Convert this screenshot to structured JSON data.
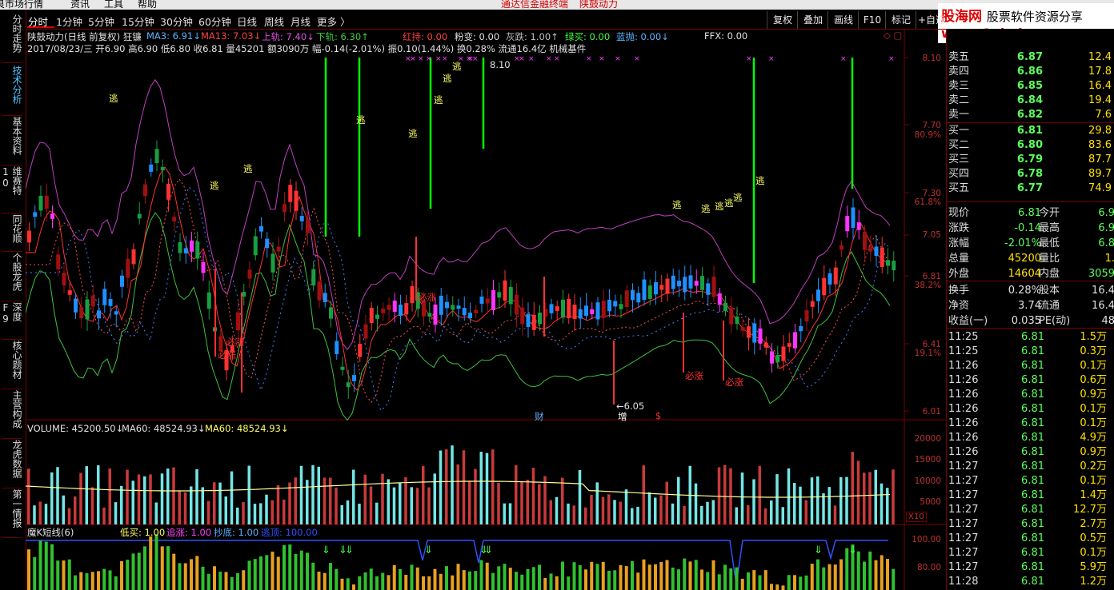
{
  "menu": {
    "items": [
      "良市场行情",
      "资讯",
      "工具",
      "帮助"
    ],
    "center": [
      "通达信金融终端",
      "陕鼓动力"
    ]
  },
  "left_tabs": [
    {
      "label": "分时走势",
      "active": false
    },
    {
      "label": "技术分析",
      "active": true
    },
    {
      "label": "基本资料",
      "active": false
    },
    {
      "label": "维赛特10",
      "active": false
    },
    {
      "label": "同花顺",
      "active": false
    },
    {
      "label": "个股龙虎",
      "active": false
    },
    {
      "label": "深度F9",
      "active": false
    },
    {
      "label": "核心题材",
      "active": false
    },
    {
      "label": "主营构成",
      "active": false
    },
    {
      "label": "龙虎数据",
      "active": false
    },
    {
      "label": "第一情报",
      "active": false
    }
  ],
  "period_tabs": [
    "分时",
    "1分钟",
    "5分钟",
    "15分钟",
    "30分钟",
    "60分钟",
    "日线",
    "周线",
    "月线",
    "更多 〉"
  ],
  "right_buttons": [
    "复权",
    "叠加",
    "画线",
    "F10",
    "标记",
    "+自选"
  ],
  "logo": {
    "line1_a": "股海网",
    "line1_b": "股票软件资源分享",
    "line2": "www.Guhai.com.cn"
  },
  "header": {
    "stock_title": "陕鼓动力(日线 前复权) 狂镰",
    "ma3": "MA3: 6.91↓",
    "ma13": "MA13: 7.03↓",
    "upper": "上轨: 7.40↓",
    "lower": "下轨: 6.30↑",
    "red_hold": "红持: 0.00",
    "pink": "粉变: 0.00",
    "gray": "灰跌: 1.00↑",
    "green_buy": "绿买: 0.00",
    "blue_throw": "蓝抛: 0.00↓",
    "ffx": "FFX: 0.00",
    "info_line": "2017/08/23/三 开6.90 高6.90 低6.80 收6.81 量45201 额3090万 幅-0.14(-2.01%) 振0.10(1.44%) 换0.28% 流通16.4亿 机械基件"
  },
  "price_axis": [
    "8.10",
    "7.70",
    "7.30",
    "7.05",
    "6.81",
    "6.41",
    "6.01"
  ],
  "pct_axis": [
    "80.9%",
    "61.8%",
    "38.2%",
    "19.1%"
  ],
  "annotations": {
    "escape": "逃",
    "must_rise": "必涨",
    "high_marker": "8.10",
    "low_marker": "←6.05",
    "cai": "财",
    "zeng": "增",
    "dollar": "$"
  },
  "volume_header": {
    "volume": "VOLUME: 45200.50↓",
    "ma60a": "MA60: 48524.93↓",
    "ma60b": "MA60: 48524.93↓"
  },
  "volume_axis": [
    "20000",
    "15000",
    "10000",
    "5000"
  ],
  "volume_unit": "X10",
  "indicator_header": {
    "name": "魔K短线(6)",
    "low_buy": "低买: 1.00",
    "chase": "追涨: 1.00",
    "bottom": "抄底: 1.00",
    "escape_top": "逃顶: 100.00"
  },
  "indicator_axis": [
    "100.00",
    "80.00"
  ],
  "order_book": [
    {
      "label": "卖五",
      "price": "6.87",
      "vol": "12.4"
    },
    {
      "label": "卖四",
      "price": "6.86",
      "vol": "17.8"
    },
    {
      "label": "卖三",
      "price": "6.85",
      "vol": "16.4"
    },
    {
      "label": "卖二",
      "price": "6.84",
      "vol": "19.4"
    },
    {
      "label": "卖一",
      "price": "6.82",
      "vol": "7.6"
    },
    {
      "label": "买一",
      "price": "6.81",
      "vol": "29.8"
    },
    {
      "label": "买二",
      "price": "6.80",
      "vol": "83.6"
    },
    {
      "label": "买三",
      "price": "6.79",
      "vol": "87.7"
    },
    {
      "label": "买四",
      "price": "6.78",
      "vol": "89.7"
    },
    {
      "label": "买五",
      "price": "6.77",
      "vol": "74.9"
    }
  ],
  "quote": [
    {
      "k1": "现价",
      "v1": "6.81",
      "k2": "今开",
      "v2": "6.9"
    },
    {
      "k1": "涨跌",
      "v1": "-0.14",
      "k2": "最高",
      "v2": "6.9"
    },
    {
      "k1": "涨幅",
      "v1": "-2.01%",
      "k2": "最低",
      "v2": "6.8"
    },
    {
      "k1": "总量",
      "v1": "45200",
      "k2": "量比",
      "v2": "1."
    },
    {
      "k1": "外盘",
      "v1": "14604",
      "k2": "内盘",
      "v2": "3059"
    },
    {
      "k1": "换手",
      "v1": "0.28%",
      "k2": "股本",
      "v2": "16.4"
    },
    {
      "k1": "净资",
      "v1": "3.74",
      "k2": "流通",
      "v2": "16.4"
    },
    {
      "k1": "收益(一)",
      "v1": "0.035",
      "k2": "PE(动)",
      "v2": "48"
    }
  ],
  "ticks": [
    {
      "t": "11:25",
      "p": "6.81",
      "v": "1.5万"
    },
    {
      "t": "11:25",
      "p": "6.81",
      "v": "0.3万"
    },
    {
      "t": "11:26",
      "p": "6.81",
      "v": "0.1万"
    },
    {
      "t": "11:26",
      "p": "6.81",
      "v": "0.6万"
    },
    {
      "t": "11:26",
      "p": "6.81",
      "v": "0.9万"
    },
    {
      "t": "11:26",
      "p": "6.81",
      "v": "0.1万"
    },
    {
      "t": "11:26",
      "p": "6.81",
      "v": "0.1万"
    },
    {
      "t": "11:26",
      "p": "6.81",
      "v": "4.9万"
    },
    {
      "t": "11:26",
      "p": "6.81",
      "v": "0.9万"
    },
    {
      "t": "11:27",
      "p": "6.81",
      "v": "0.2万"
    },
    {
      "t": "11:27",
      "p": "6.81",
      "v": "0.1万"
    },
    {
      "t": "11:27",
      "p": "6.81",
      "v": "1.4万"
    },
    {
      "t": "11:27",
      "p": "6.81",
      "v": "12.7万"
    },
    {
      "t": "11:27",
      "p": "6.81",
      "v": "2.7万"
    },
    {
      "t": "11:27",
      "p": "6.81",
      "v": "0.5万"
    },
    {
      "t": "11:27",
      "p": "6.81",
      "v": "0.1万"
    },
    {
      "t": "11:27",
      "p": "6.81",
      "v": "5.9万"
    },
    {
      "t": "11:28",
      "p": "6.81",
      "v": "1.2万"
    }
  ],
  "colors": {
    "up": "#ff3232",
    "down": "#00e5ff",
    "blue_bar": "#1e90ff",
    "magenta": "#ff33ff",
    "green_line": "#00ff00",
    "upper_band": "#c040c0",
    "lower_band": "#40c040",
    "ma": "#ff3030",
    "grid": "#7a0000",
    "text_yellow": "#ffff66"
  }
}
